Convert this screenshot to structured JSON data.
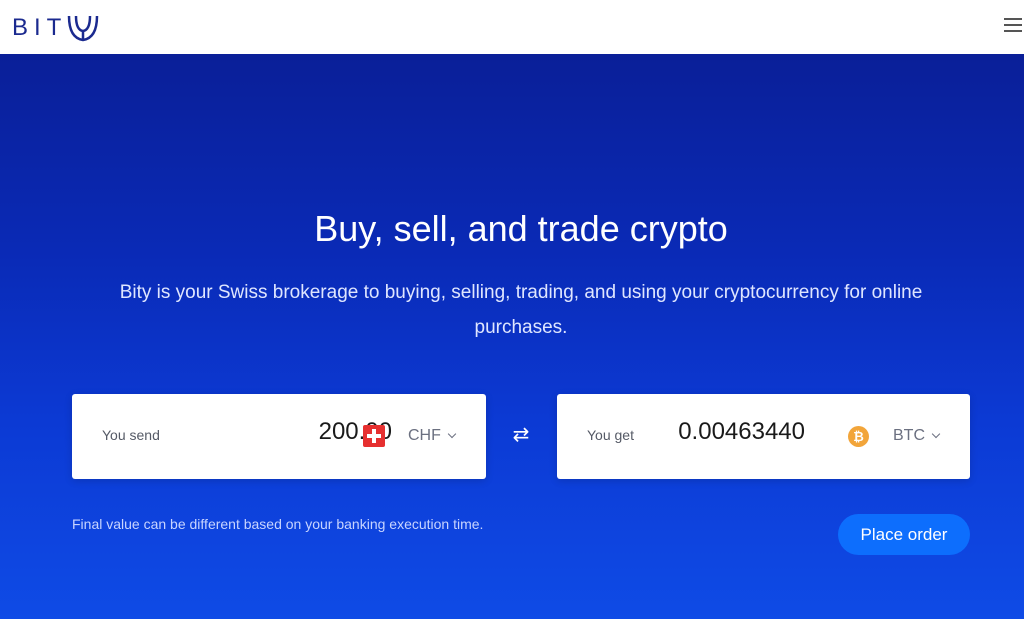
{
  "header": {
    "logo_text": "BIT",
    "logo_name": "bity-logo",
    "menu_icon": "hamburger-menu-icon"
  },
  "hero": {
    "title": "Buy, sell, and trade crypto",
    "subtitle": "Bity is your Swiss brokerage to buying, selling, trading, and using your cryptocurrency for online purchases."
  },
  "exchange": {
    "send": {
      "label": "You send",
      "amount": "200.00",
      "currency": "CHF",
      "icon": "swiss-flag-icon"
    },
    "swap_icon": "swap-arrows-icon",
    "swap_glyph": "⇄",
    "get": {
      "label": "You get",
      "amount": "0.00463440",
      "currency": "BTC",
      "icon": "bitcoin-icon",
      "icon_glyph": "₿"
    },
    "disclaimer": "Final value can be different based on your banking execution time.",
    "place_order_label": "Place order"
  },
  "colors": {
    "brand_navy": "#1b2a8f",
    "hero_top": "#0a1f98",
    "hero_bottom": "#0f4be6",
    "button_blue": "#0d6efd",
    "chf_red": "#e62f2f",
    "btc_orange": "#f2a53a"
  }
}
